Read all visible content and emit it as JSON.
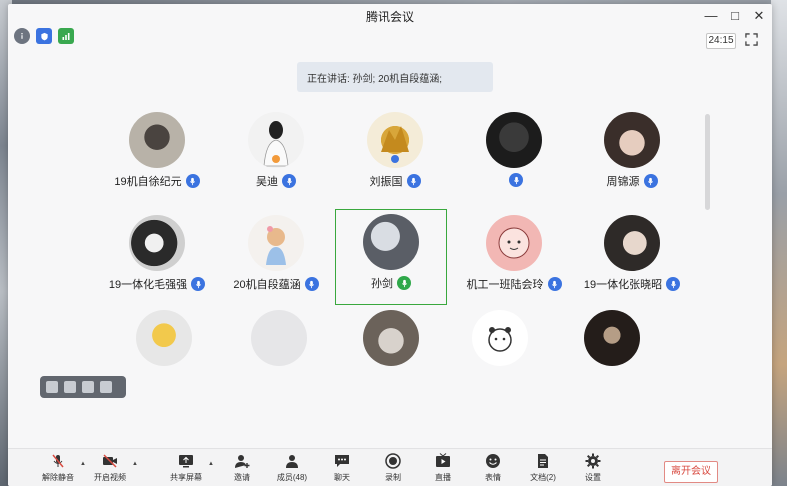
{
  "window": {
    "title": "腾讯会议"
  },
  "window_controls": {
    "minimize": "—",
    "maximize": "□",
    "close": "✕"
  },
  "toolbar": {
    "timer": "24:15"
  },
  "speaking": {
    "text": "正在讲话: 孙剑; 20机自段蕴涵;"
  },
  "participants": [
    {
      "name": "19机自徐纪元",
      "mic": "blue"
    },
    {
      "name": "吴迪",
      "mic": "blue"
    },
    {
      "name": "刘振国",
      "mic": "blue"
    },
    {
      "name": "",
      "mic": "blue"
    },
    {
      "name": "周锦源",
      "mic": "blue"
    },
    {
      "name": "19一体化毛强强",
      "mic": "blue"
    },
    {
      "name": "20机自段蕴涵",
      "mic": "blue"
    },
    {
      "name": "孙剑",
      "mic": "green"
    },
    {
      "name": "机工一班陆会玲",
      "mic": "blue"
    },
    {
      "name": "19一体化张晓昭",
      "mic": "blue"
    }
  ],
  "bottom_bar": {
    "mute": "解除静音",
    "video": "开启视频",
    "share": "共享屏幕",
    "invite": "邀请",
    "members": "成员(48)",
    "chat": "聊天",
    "record": "录制",
    "live": "直播",
    "reactions": "表情",
    "docs": "文档(2)",
    "settings": "设置",
    "leave": "离开会议"
  },
  "colors": {
    "accent_blue": "#3b73e0",
    "speaking_green": "#2fa84a",
    "leave_red": "#d84a40"
  }
}
